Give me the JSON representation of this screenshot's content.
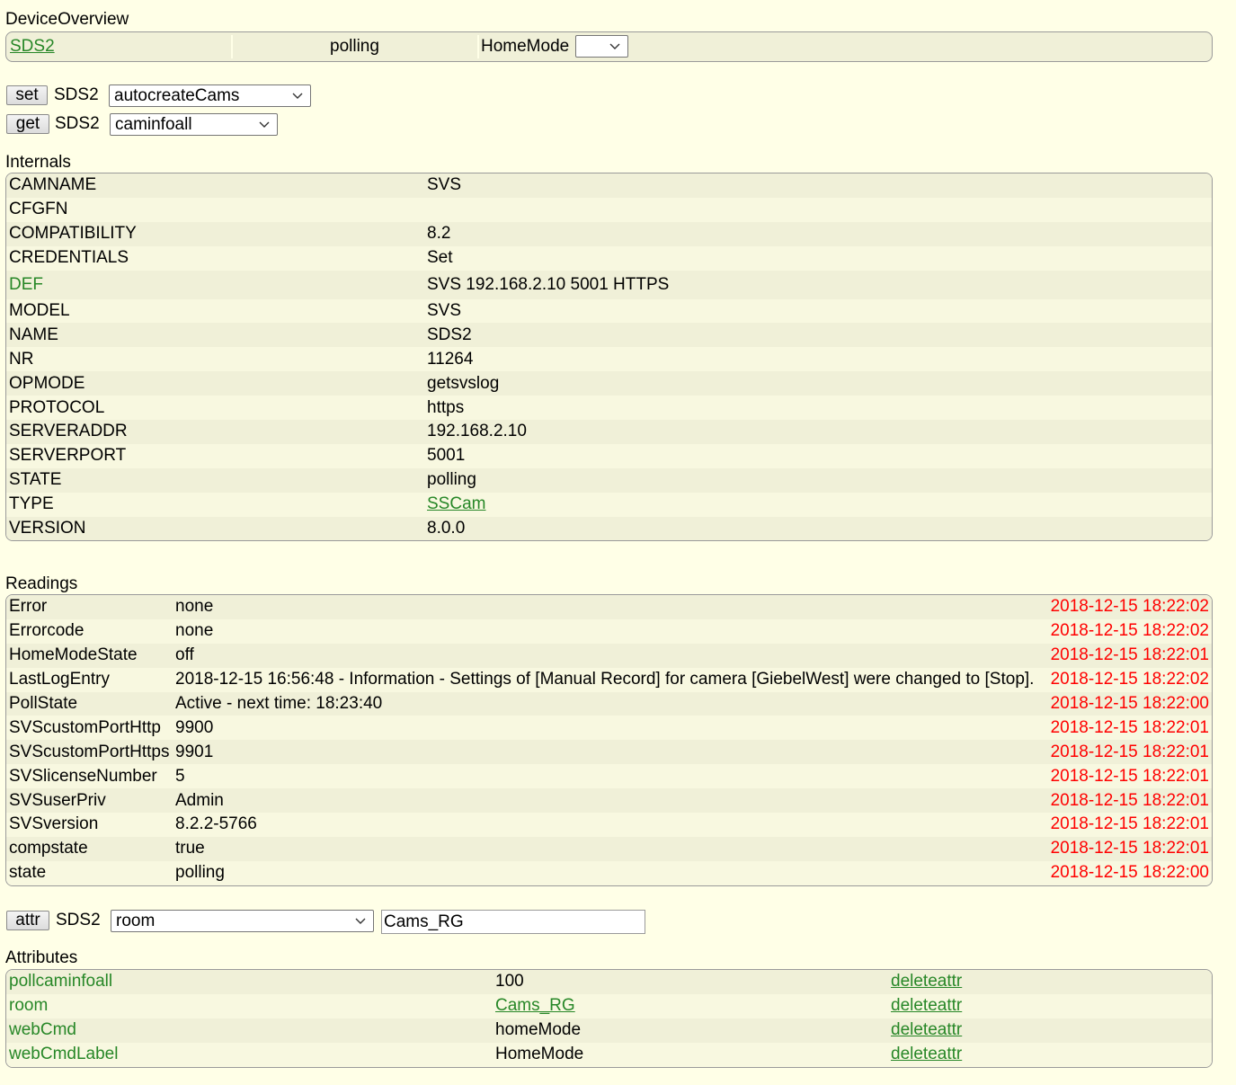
{
  "overview": {
    "title": "DeviceOverview",
    "device_name": "SDS2",
    "state": "polling",
    "homemode_label": "HomeMode",
    "homemode_value": ""
  },
  "set_row": {
    "button": "set",
    "device": "SDS2",
    "selected": "autocreateCams"
  },
  "get_row": {
    "button": "get",
    "device": "SDS2",
    "selected": "caminfoall"
  },
  "internals": {
    "title": "Internals",
    "rows": [
      {
        "name": "CAMNAME",
        "value": "SVS"
      },
      {
        "name": "CFGFN",
        "value": ""
      },
      {
        "name": "COMPATIBILITY",
        "value": "8.2"
      },
      {
        "name": "CREDENTIALS",
        "value": "Set"
      },
      {
        "name": "DEF",
        "value": "SVS 192.168.2.10 5001 HTTPS"
      },
      {
        "name": "MODEL",
        "value": "SVS"
      },
      {
        "name": "NAME",
        "value": "SDS2"
      },
      {
        "name": "NR",
        "value": "11264"
      },
      {
        "name": "OPMODE",
        "value": "getsvslog"
      },
      {
        "name": "PROTOCOL",
        "value": "https"
      },
      {
        "name": "SERVERADDR",
        "value": "192.168.2.10"
      },
      {
        "name": "SERVERPORT",
        "value": "5001"
      },
      {
        "name": "STATE",
        "value": "polling"
      },
      {
        "name": "TYPE",
        "value": "SSCam"
      },
      {
        "name": "VERSION",
        "value": "8.0.0"
      }
    ]
  },
  "readings": {
    "title": "Readings",
    "rows": [
      {
        "name": "Error",
        "value": "none",
        "time": "2018-12-15 18:22:02"
      },
      {
        "name": "Errorcode",
        "value": "none",
        "time": "2018-12-15 18:22:02"
      },
      {
        "name": "HomeModeState",
        "value": "off",
        "time": "2018-12-15 18:22:01"
      },
      {
        "name": "LastLogEntry",
        "value": "2018-12-15 16:56:48 - Information - Settings of [Manual Record] for camera [GiebelWest] were changed to [Stop].",
        "time": "2018-12-15 18:22:02"
      },
      {
        "name": "PollState",
        "value": "Active - next time: 18:23:40",
        "time": "2018-12-15 18:22:00"
      },
      {
        "name": "SVScustomPortHttp",
        "value": "9900",
        "time": "2018-12-15 18:22:01"
      },
      {
        "name": "SVScustomPortHttps",
        "value": "9901",
        "time": "2018-12-15 18:22:01"
      },
      {
        "name": "SVSlicenseNumber",
        "value": "5",
        "time": "2018-12-15 18:22:01"
      },
      {
        "name": "SVSuserPriv",
        "value": "Admin",
        "time": "2018-12-15 18:22:01"
      },
      {
        "name": "SVSversion",
        "value": "8.2.2-5766",
        "time": "2018-12-15 18:22:01"
      },
      {
        "name": "compstate",
        "value": "true",
        "time": "2018-12-15 18:22:01"
      },
      {
        "name": "state",
        "value": "polling",
        "time": "2018-12-15 18:22:00"
      }
    ]
  },
  "attr_row": {
    "button": "attr",
    "device": "SDS2",
    "selected": "room",
    "value": "Cams_RG"
  },
  "attributes": {
    "title": "Attributes",
    "delete_label": "deleteattr",
    "rows": [
      {
        "name": "pollcaminfoall",
        "value": "100"
      },
      {
        "name": "room",
        "value": "Cams_RG"
      },
      {
        "name": "webCmd",
        "value": "homeMode"
      },
      {
        "name": "webCmdLabel",
        "value": "HomeMode"
      }
    ]
  },
  "colors": {
    "background": "#FFFFE7",
    "row_odd": "#F0F0D8",
    "row_even": "#F8F8E0",
    "link": "#278727",
    "timestamp": "#FF0000"
  }
}
